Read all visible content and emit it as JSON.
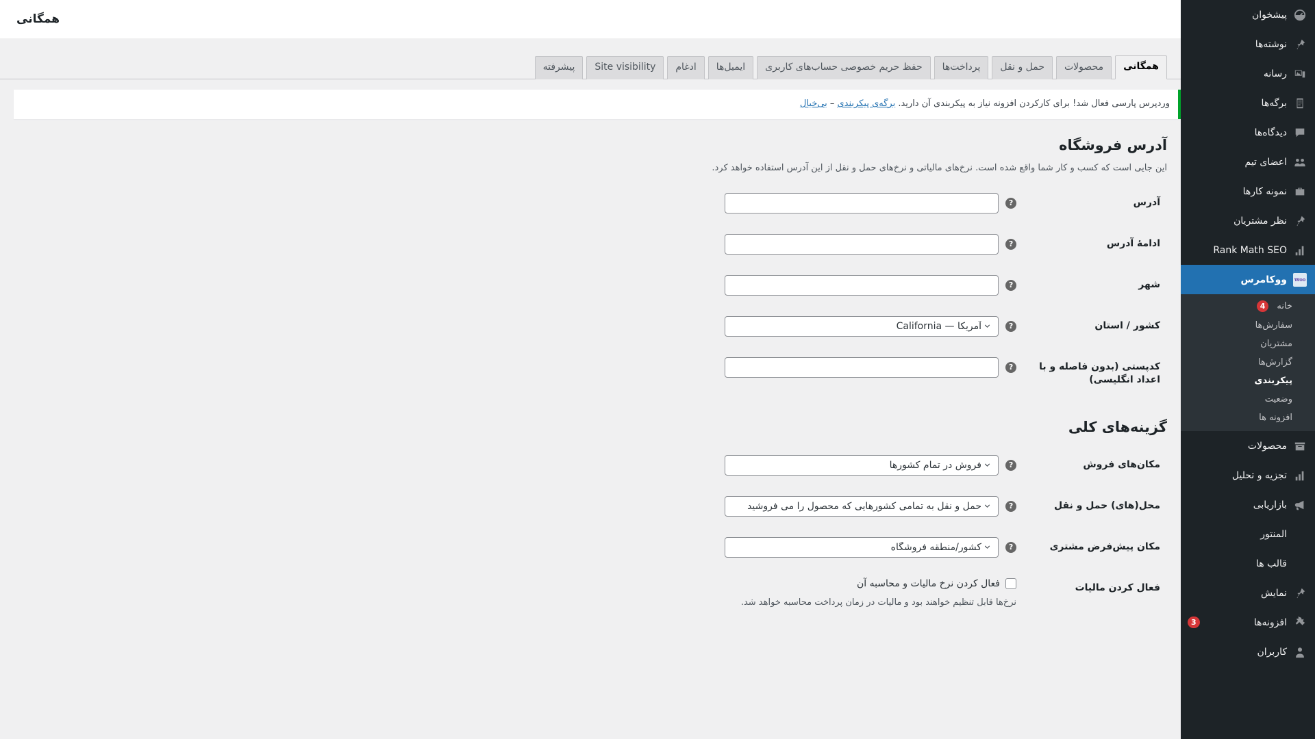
{
  "colors": {
    "sidebar_bg": "#1d2327",
    "submenu_bg": "#2c3338",
    "accent": "#2271b1",
    "notice_green": "#00a32a",
    "badge_red": "#d63638",
    "link": "#2271b1"
  },
  "sidebar": {
    "items": [
      {
        "label": "پیشخوان",
        "icon": "dashboard-icon",
        "current": false
      },
      {
        "label": "نوشته‌ها",
        "icon": "pin-icon",
        "current": false
      },
      {
        "label": "رسانه",
        "icon": "media-icon",
        "current": false
      },
      {
        "label": "برگه‌ها",
        "icon": "pages-icon",
        "current": false
      },
      {
        "label": "دیدگاه‌ها",
        "icon": "comments-icon",
        "current": false
      },
      {
        "label": "اعضای تیم",
        "icon": "team-icon",
        "current": false
      },
      {
        "label": "نمونه کارها",
        "icon": "portfolio-icon",
        "current": false
      },
      {
        "label": "نظر مشتریان",
        "icon": "pin-icon",
        "current": false
      },
      {
        "label": "Rank Math SEO",
        "icon": "chart-icon",
        "current": false
      },
      {
        "label": "ووکامرس",
        "icon": "woo-icon",
        "current": true
      },
      {
        "label": "محصولات",
        "icon": "products-icon",
        "current": false
      },
      {
        "label": "تجزیه و تحلیل",
        "icon": "analytics-icon",
        "current": false
      },
      {
        "label": "بازاریابی",
        "icon": "marketing-icon",
        "current": false
      },
      {
        "label": "المنتور",
        "icon": "elementor-icon",
        "current": false
      },
      {
        "label": "قالب ها",
        "icon": "templates-icon",
        "current": false
      },
      {
        "label": "نمایش",
        "icon": "appearance-icon",
        "current": false
      },
      {
        "label": "افزونه‌ها",
        "icon": "plugins-icon",
        "current": false,
        "count": "3"
      },
      {
        "label": "کاربران",
        "icon": "users-icon",
        "current": false
      }
    ],
    "woo_submenu": [
      {
        "label": "خانه",
        "current": false,
        "count": "4"
      },
      {
        "label": "سفارش‌ها",
        "current": false
      },
      {
        "label": "مشتریان",
        "current": false
      },
      {
        "label": "گزارش‌ها",
        "current": false
      },
      {
        "label": "پیکربندی",
        "current": true
      },
      {
        "label": "وضعیت",
        "current": false
      },
      {
        "label": "افزونه ها",
        "current": false
      }
    ],
    "woo_badge_text": "Woo"
  },
  "header": {
    "title": "همگانی"
  },
  "tabs": [
    {
      "label": "همگانی",
      "active": true
    },
    {
      "label": "محصولات",
      "active": false
    },
    {
      "label": "حمل و نقل",
      "active": false
    },
    {
      "label": "پرداخت‌ها",
      "active": false
    },
    {
      "label": "حفظ حریم خصوصی حساب‌های کاربری",
      "active": false
    },
    {
      "label": "ایمیل‌ها",
      "active": false
    },
    {
      "label": "ادغام",
      "active": false
    },
    {
      "label": "Site visibility",
      "active": false
    },
    {
      "label": "پیشرفته",
      "active": false
    }
  ],
  "notice": {
    "text": "وردپرس پارسی فعال شد! برای کارکردن افزونه نیاز به پیکربندی آن دارید.",
    "link_config": "برگه‌ی پیکربندی",
    "separator": " – ",
    "link_dismiss": "بی‌خیال"
  },
  "store_address": {
    "title": "آدرس فروشگاه",
    "description": "این جایی است که کسب و کار شما واقع شده است. نرخ‌های مالیاتی و نرخ‌های حمل و نقل از این آدرس استفاده خواهد کرد.",
    "fields": [
      {
        "label": "آدرس",
        "type": "text",
        "value": "",
        "placeholder": ""
      },
      {
        "label": "ادامهٔ آدرس",
        "type": "text",
        "value": "",
        "placeholder": ""
      },
      {
        "label": "شهر",
        "type": "text",
        "value": "",
        "placeholder": ""
      },
      {
        "label": "کشور / استان",
        "type": "select",
        "value": "آمریکا — California"
      },
      {
        "label": "کدپستی (بدون فاصله و با اعداد انگلیسی)",
        "type": "text",
        "value": "",
        "placeholder": ""
      }
    ]
  },
  "general_options": {
    "title": "گزینه‌های کلی",
    "fields": [
      {
        "label": "مکان‌های فروش",
        "type": "select",
        "value": "فروش در تمام کشورها"
      },
      {
        "label": "محل(های) حمل و نقل",
        "type": "select",
        "value": "حمل و نقل به تمامی کشورهایی که محصول را می فروشید"
      },
      {
        "label": "مکان پیش‌فرض مشتری",
        "type": "select",
        "value": "کشور/منطقه فروشگاه"
      },
      {
        "label": "فعال کردن مالیات",
        "type": "checkbox",
        "checkbox_label": "فعال کردن نرخ مالیات و محاسبه آن",
        "checked": false
      }
    ],
    "tax_note": "نرخ‌ها قابل تنظیم خواهند بود و مالیات در زمان پرداخت محاسبه خواهد شد."
  },
  "icons": {
    "help_glyph": "?"
  }
}
